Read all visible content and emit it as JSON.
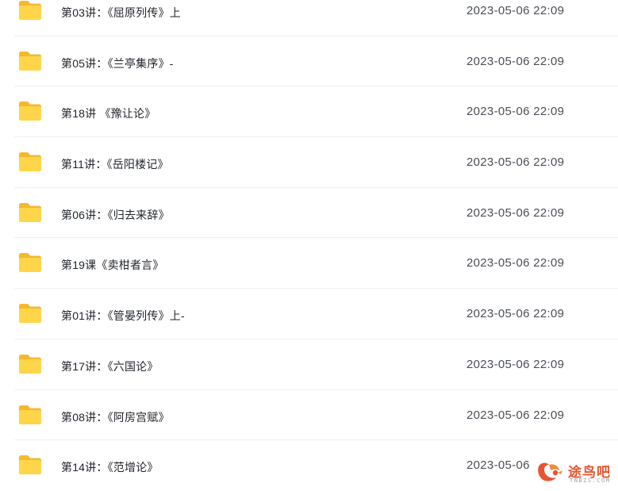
{
  "files": [
    {
      "name": "第03讲：《屈原列传》上",
      "date": "2023-05-06 22:09",
      "icon": "folder-icon"
    },
    {
      "name": "第05讲：《兰亭集序》-",
      "date": "2023-05-06 22:09",
      "icon": "folder-icon"
    },
    {
      "name": "第18讲 《豫让论》",
      "date": "2023-05-06 22:09",
      "icon": "folder-icon"
    },
    {
      "name": "第11讲：《岳阳楼记》",
      "date": "2023-05-06 22:09",
      "icon": "folder-icon"
    },
    {
      "name": "第06讲：《归去来辞》",
      "date": "2023-05-06 22:09",
      "icon": "folder-icon"
    },
    {
      "name": "第19课《卖柑者言》",
      "date": "2023-05-06 22:09",
      "icon": "folder-icon"
    },
    {
      "name": "第01讲：《管晏列传》上-",
      "date": "2023-05-06 22:09",
      "icon": "folder-icon"
    },
    {
      "name": "第17讲：《六国论》",
      "date": "2023-05-06 22:09",
      "icon": "folder-icon"
    },
    {
      "name": "第08讲：《阿房宫赋》",
      "date": "2023-05-06 22:09",
      "icon": "folder-icon"
    },
    {
      "name": "第14讲：《范增论》",
      "date": "2023-05-06",
      "icon": "folder-icon"
    }
  ],
  "watermark": {
    "text": "途鸟吧",
    "subtext": "TNBZS.COM"
  },
  "colors": {
    "folder_front": "#ffd54a",
    "folder_back": "#f5b82e",
    "watermark": "#e8542f"
  }
}
